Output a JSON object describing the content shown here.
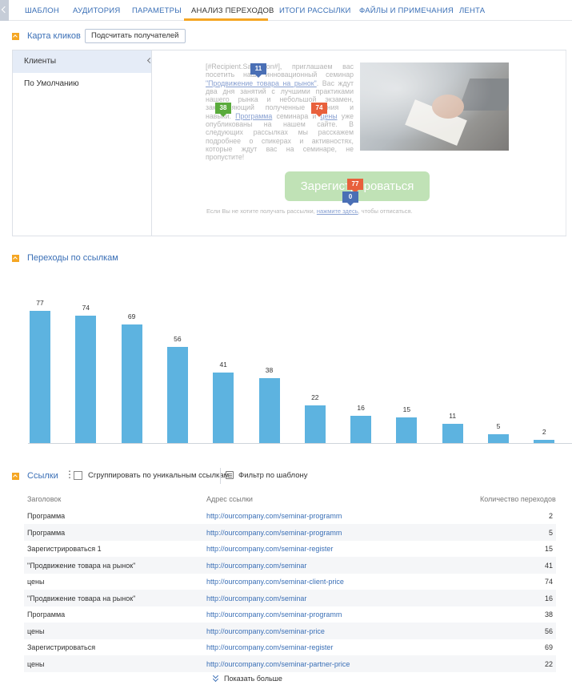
{
  "tabs": [
    {
      "label": "ШАБЛОН"
    },
    {
      "label": "АУДИТОРИЯ"
    },
    {
      "label": "ПАРАМЕТРЫ"
    },
    {
      "label": "АНАЛИЗ ПЕРЕХОДОВ"
    },
    {
      "label": "ИТОГИ РАССЫЛКИ"
    },
    {
      "label": "ФАЙЛЫ И ПРИМЕЧАНИЯ"
    },
    {
      "label": "ЛЕНТА"
    }
  ],
  "active_tab": "АНАЛИЗ ПЕРЕХОДОВ",
  "clickmap": {
    "title": "Карта кликов",
    "count_button": "Подсчитать получателей",
    "segments": [
      "Клиенты",
      "По Умолчанию"
    ],
    "letter": {
      "p1": "[#Recipient.Salutation#], приглашаем вас посетить наш инновационный семинар",
      "link1": "\"Продвижение товара на рынок\"",
      "p2": ". Вас ждут два дня занятий с лучшими практиками нашего рынка и небольшой экзамен, закрепляющий полученные знания и навыки.",
      "link2": "Программа",
      "p3": " семинара и ",
      "link3": "цены",
      "p4": " уже опубликованы на нашем сайте. В следующих рассылках мы расскажем подробнее о спикерах и активностях, которые ждут вас на семинаре, не пропустите!",
      "register_button": "Зарегистрироваться",
      "unsub_before": "Если Вы не хотите получать рассылки, ",
      "unsub_link": "нажмите здесь",
      "unsub_after": ", чтобы отписаться."
    },
    "bubbles": [
      {
        "value": "11",
        "color": "#4a6fb5"
      },
      {
        "value": "38",
        "color": "#5aab3c"
      },
      {
        "value": "74",
        "color": "#e8603c"
      },
      {
        "value": "77",
        "color": "#e8603c"
      },
      {
        "value": "0",
        "color": "#4a6fb5"
      }
    ]
  },
  "chart_section": {
    "title": "Переходы по ссылкам"
  },
  "chart_data": {
    "type": "bar",
    "values": [
      77,
      74,
      69,
      56,
      41,
      38,
      22,
      16,
      15,
      11,
      5,
      2
    ],
    "color": "#5db3e0",
    "ylim": [
      0,
      77
    ]
  },
  "links": {
    "title": "Ссылки",
    "group_label": "Сгруппировать по уникальным ссылкам",
    "filter_label": "Фильтр по шаблону",
    "columns": [
      "Заголовок",
      "Адрес ссылки",
      "Количество переходов"
    ],
    "rows": [
      {
        "title": "Программа",
        "url": "http://ourcompany.com/seminar-programm",
        "count": "2"
      },
      {
        "title": "Программа",
        "url": "http://ourcompany.com/seminar-programm",
        "count": "5"
      },
      {
        "title": "Зарегистрироваться 1",
        "url": "http://ourcompany.com/seminar-register",
        "count": "15"
      },
      {
        "title": "\"Продвижение товара на рынок\"",
        "url": "http://ourcompany.com/seminar",
        "count": "41"
      },
      {
        "title": "цены",
        "url": "http://ourcompany.com/seminar-client-price",
        "count": "74"
      },
      {
        "title": "\"Продвижение товара на рынок\"",
        "url": "http://ourcompany.com/seminar",
        "count": "16"
      },
      {
        "title": "Программа",
        "url": "http://ourcompany.com/seminar-programm",
        "count": "38"
      },
      {
        "title": "цены",
        "url": "http://ourcompany.com/seminar-price",
        "count": "56"
      },
      {
        "title": "Зарегистрироваться",
        "url": "http://ourcompany.com/seminar-register",
        "count": "69"
      },
      {
        "title": "цены",
        "url": "http://ourcompany.com/seminar-partner-price",
        "count": "22"
      }
    ],
    "show_more": "Показать больше"
  }
}
